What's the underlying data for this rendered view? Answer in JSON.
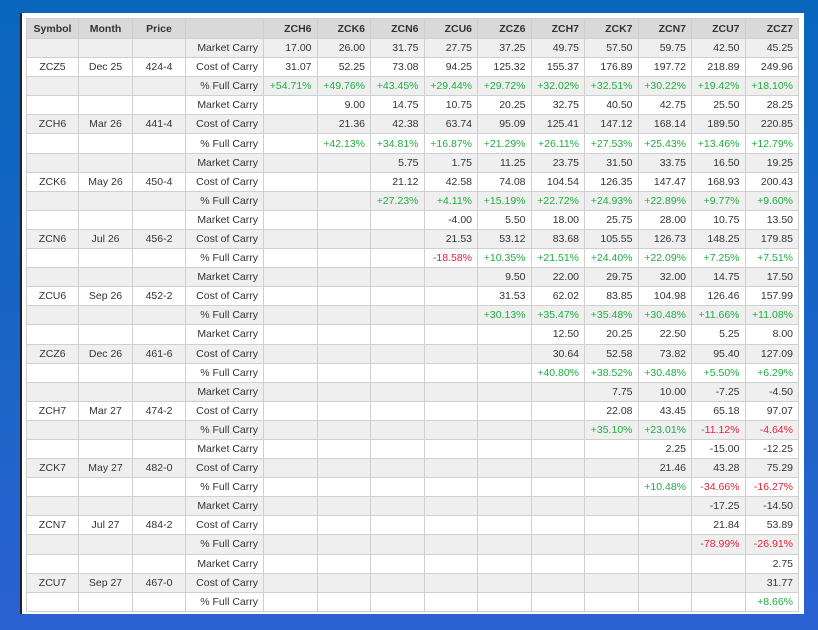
{
  "headers": {
    "symbol": "Symbol",
    "month": "Month",
    "price": "Price",
    "label": ""
  },
  "contracts": [
    "ZCH6",
    "ZCK6",
    "ZCN6",
    "ZCU6",
    "ZCZ6",
    "ZCH7",
    "ZCK7",
    "ZCN7",
    "ZCU7",
    "ZCZ7"
  ],
  "row_labels": {
    "market": "Market Carry",
    "cost": "Cost of Carry",
    "full": "% Full Carry"
  },
  "colors": {
    "positive": "#1fae3f",
    "negative": "#e3213a",
    "header_bg": "#d9d9d9",
    "stripe": "#efefef"
  },
  "groups": [
    {
      "symbol": "ZCZ5",
      "month": "Dec 25",
      "price": "424-4",
      "market": [
        "17.00",
        "26.00",
        "31.75",
        "27.75",
        "37.25",
        "49.75",
        "57.50",
        "59.75",
        "42.50",
        "45.25"
      ],
      "cost": [
        "31.07",
        "52.25",
        "73.08",
        "94.25",
        "125.32",
        "155.37",
        "176.89",
        "197.72",
        "218.89",
        "249.96"
      ],
      "full": [
        "+54.71%",
        "+49.76%",
        "+43.45%",
        "+29.44%",
        "+29.72%",
        "+32.02%",
        "+32.51%",
        "+30.22%",
        "+19.42%",
        "+18.10%"
      ]
    },
    {
      "symbol": "ZCH6",
      "month": "Mar 26",
      "price": "441-4",
      "market": [
        "",
        "9.00",
        "14.75",
        "10.75",
        "20.25",
        "32.75",
        "40.50",
        "42.75",
        "25.50",
        "28.25"
      ],
      "cost": [
        "",
        "21.36",
        "42.38",
        "63.74",
        "95.09",
        "125.41",
        "147.12",
        "168.14",
        "189.50",
        "220.85"
      ],
      "full": [
        "",
        "+42.13%",
        "+34.81%",
        "+16.87%",
        "+21.29%",
        "+26.11%",
        "+27.53%",
        "+25.43%",
        "+13.46%",
        "+12.79%"
      ]
    },
    {
      "symbol": "ZCK6",
      "month": "May 26",
      "price": "450-4",
      "market": [
        "",
        "",
        "5.75",
        "1.75",
        "11.25",
        "23.75",
        "31.50",
        "33.75",
        "16.50",
        "19.25"
      ],
      "cost": [
        "",
        "",
        "21.12",
        "42.58",
        "74.08",
        "104.54",
        "126.35",
        "147.47",
        "168.93",
        "200.43"
      ],
      "full": [
        "",
        "",
        "+27.23%",
        "+4.11%",
        "+15.19%",
        "+22.72%",
        "+24.93%",
        "+22.89%",
        "+9.77%",
        "+9.60%"
      ]
    },
    {
      "symbol": "ZCN6",
      "month": "Jul 26",
      "price": "456-2",
      "market": [
        "",
        "",
        "",
        "-4.00",
        "5.50",
        "18.00",
        "25.75",
        "28.00",
        "10.75",
        "13.50"
      ],
      "cost": [
        "",
        "",
        "",
        "21.53",
        "53.12",
        "83.68",
        "105.55",
        "126.73",
        "148.25",
        "179.85"
      ],
      "full": [
        "",
        "",
        "",
        "-18.58%",
        "+10.35%",
        "+21.51%",
        "+24.40%",
        "+22.09%",
        "+7.25%",
        "+7.51%"
      ]
    },
    {
      "symbol": "ZCU6",
      "month": "Sep 26",
      "price": "452-2",
      "market": [
        "",
        "",
        "",
        "",
        "9.50",
        "22.00",
        "29.75",
        "32.00",
        "14.75",
        "17.50"
      ],
      "cost": [
        "",
        "",
        "",
        "",
        "31.53",
        "62.02",
        "83.85",
        "104.98",
        "126.46",
        "157.99"
      ],
      "full": [
        "",
        "",
        "",
        "",
        "+30.13%",
        "+35.47%",
        "+35.48%",
        "+30.48%",
        "+11.66%",
        "+11.08%"
      ]
    },
    {
      "symbol": "ZCZ6",
      "month": "Dec 26",
      "price": "461-6",
      "market": [
        "",
        "",
        "",
        "",
        "",
        "12.50",
        "20.25",
        "22.50",
        "5.25",
        "8.00"
      ],
      "cost": [
        "",
        "",
        "",
        "",
        "",
        "30.64",
        "52.58",
        "73.82",
        "95.40",
        "127.09"
      ],
      "full": [
        "",
        "",
        "",
        "",
        "",
        "+40.80%",
        "+38.52%",
        "+30.48%",
        "+5.50%",
        "+6.29%"
      ]
    },
    {
      "symbol": "ZCH7",
      "month": "Mar 27",
      "price": "474-2",
      "market": [
        "",
        "",
        "",
        "",
        "",
        "",
        "7.75",
        "10.00",
        "-7.25",
        "-4.50"
      ],
      "cost": [
        "",
        "",
        "",
        "",
        "",
        "",
        "22.08",
        "43.45",
        "65.18",
        "97.07"
      ],
      "full": [
        "",
        "",
        "",
        "",
        "",
        "",
        "+35.10%",
        "+23.01%",
        "-11.12%",
        "-4.64%"
      ]
    },
    {
      "symbol": "ZCK7",
      "month": "May 27",
      "price": "482-0",
      "market": [
        "",
        "",
        "",
        "",
        "",
        "",
        "",
        "2.25",
        "-15.00",
        "-12.25"
      ],
      "cost": [
        "",
        "",
        "",
        "",
        "",
        "",
        "",
        "21.46",
        "43.28",
        "75.29"
      ],
      "full": [
        "",
        "",
        "",
        "",
        "",
        "",
        "",
        "+10.48%",
        "-34.66%",
        "-16.27%"
      ]
    },
    {
      "symbol": "ZCN7",
      "month": "Jul 27",
      "price": "484-2",
      "market": [
        "",
        "",
        "",
        "",
        "",
        "",
        "",
        "",
        "-17.25",
        "-14.50"
      ],
      "cost": [
        "",
        "",
        "",
        "",
        "",
        "",
        "",
        "",
        "21.84",
        "53.89"
      ],
      "full": [
        "",
        "",
        "",
        "",
        "",
        "",
        "",
        "",
        "-78.99%",
        "-26.91%"
      ]
    },
    {
      "symbol": "ZCU7",
      "month": "Sep 27",
      "price": "467-0",
      "market": [
        "",
        "",
        "",
        "",
        "",
        "",
        "",
        "",
        "",
        "2.75"
      ],
      "cost": [
        "",
        "",
        "",
        "",
        "",
        "",
        "",
        "",
        "",
        "31.77"
      ],
      "full": [
        "",
        "",
        "",
        "",
        "",
        "",
        "",
        "",
        "",
        "+8.66%"
      ]
    }
  ]
}
